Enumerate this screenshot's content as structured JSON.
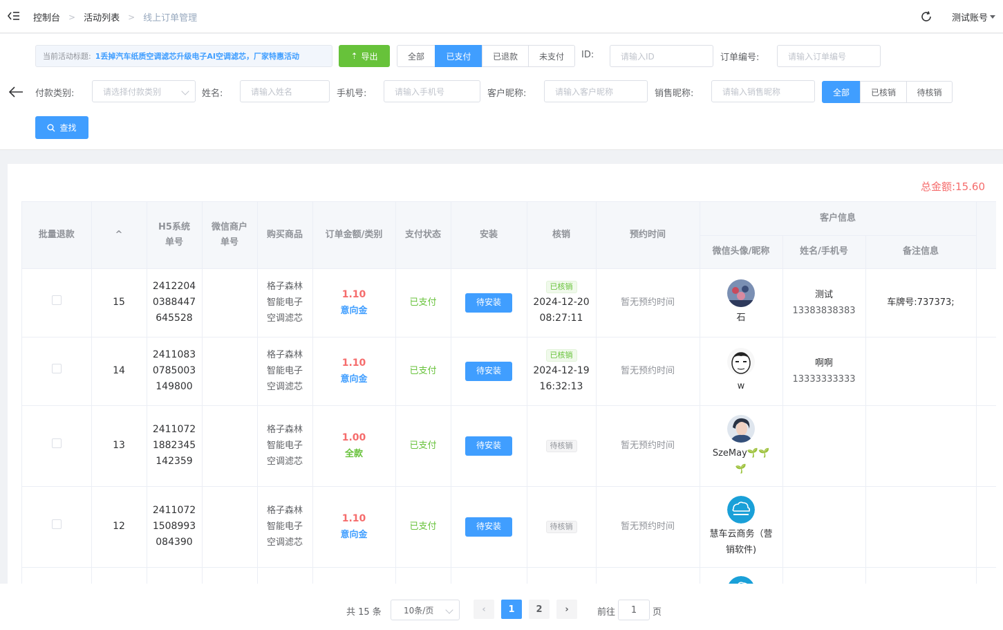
{
  "header": {
    "breadcrumbs": [
      "控制台",
      "活动列表",
      "线上订单管理"
    ],
    "account": "测试账号"
  },
  "filters": {
    "activity_label": "当前活动标题:",
    "activity_title": "1丢掉汽车纸质空调滤芯升级电子AI空调滤芯，厂家特惠活动",
    "export_label": "导出",
    "pay_status_tabs": [
      "全部",
      "已支付",
      "已退款",
      "未支付"
    ],
    "pay_status_active": "已支付",
    "id_label": "ID:",
    "id_placeholder": "请输入ID",
    "order_no_label": "订单编号:",
    "order_no_placeholder": "请输入订单编号",
    "pay_type_label": "付款类别:",
    "pay_type_placeholder": "请选择付款类别",
    "name_label": "姓名:",
    "name_placeholder": "请输入姓名",
    "phone_label": "手机号:",
    "phone_placeholder": "请输入手机号",
    "customer_nick_label": "客户昵称:",
    "customer_nick_placeholder": "请输入客户昵称",
    "sales_nick_label": "销售昵称:",
    "sales_nick_placeholder": "请输入销售昵称",
    "verify_tabs": [
      "全部",
      "已核销",
      "待核销"
    ],
    "verify_active": "全部",
    "search_label": "查找"
  },
  "summary": {
    "total_label": "总金额:",
    "total_value": "15.60"
  },
  "table": {
    "headers": {
      "batch_refund": "批量退款",
      "sort": "^",
      "h5_order": [
        "H5系统",
        "单号"
      ],
      "wx_order": [
        "微信商户",
        "单号"
      ],
      "product": "购买商品",
      "amount_type": "订单金额/类别",
      "pay_status": "支付状态",
      "install": "安装",
      "verify": "核销",
      "appointment": "预约时间",
      "customer_info": "客户信息",
      "wx_avatar": "微信头像/昵称",
      "name_phone": "姓名/手机号",
      "remark": "备注信息"
    },
    "rows": [
      {
        "id": "15",
        "h5": [
          "2412204",
          "0388447",
          "645528"
        ],
        "product": [
          "格子森林",
          "智能电子",
          "空调滤芯"
        ],
        "amount": "1.10",
        "type": "意向金",
        "type_color": "blue",
        "pay_status": "已支付",
        "install": "待安装",
        "verify_tag": "已核销",
        "verified": true,
        "verify_date": "2024-12-20",
        "verify_time": "08:27:11",
        "appointment": "暂无预约时间",
        "avatar_icon": "crowd-photo-avatar",
        "nick": [
          "石"
        ],
        "name": "测试",
        "phone": "13383838383",
        "remark": "车牌号:737373;"
      },
      {
        "id": "14",
        "h5": [
          "2411083",
          "0785003",
          "149800"
        ],
        "product": [
          "格子森林",
          "智能电子",
          "空调滤芯"
        ],
        "amount": "1.10",
        "type": "意向金",
        "type_color": "blue",
        "pay_status": "已支付",
        "install": "待安装",
        "verify_tag": "已核销",
        "verified": true,
        "verify_date": "2024-12-19",
        "verify_time": "16:32:13",
        "appointment": "暂无预约时间",
        "avatar_icon": "cartoon-face-avatar",
        "nick": [
          "w"
        ],
        "name": "啊啊",
        "phone": "13333333333",
        "remark": ""
      },
      {
        "id": "13",
        "h5": [
          "2411072",
          "1882345",
          "142359"
        ],
        "product": [
          "格子森林",
          "智能电子",
          "空调滤芯"
        ],
        "amount": "1.00",
        "type": "全款",
        "type_color": "green",
        "pay_status": "已支付",
        "install": "待安装",
        "verify_tag": "待核销",
        "verified": false,
        "verify_date": "",
        "verify_time": "",
        "appointment": "暂无预约时间",
        "avatar_icon": "portrait-avatar",
        "nick": [
          "SzeMay🌱🌱",
          "🌱"
        ],
        "name": "",
        "phone": "",
        "remark": ""
      },
      {
        "id": "12",
        "h5": [
          "2411072",
          "1508993",
          "084390"
        ],
        "product": [
          "格子森林",
          "智能电子",
          "空调滤芯"
        ],
        "amount": "1.10",
        "type": "意向金",
        "type_color": "blue",
        "pay_status": "已支付",
        "install": "待安装",
        "verify_tag": "待核销",
        "verified": false,
        "verify_date": "",
        "verify_time": "",
        "appointment": "暂无预约时间",
        "avatar_icon": "company-logo-avatar",
        "nick": [
          "慧车云商务（营",
          "销软件)"
        ],
        "name": "",
        "phone": "",
        "remark": ""
      }
    ]
  },
  "pagination": {
    "total_text": "共 15 条",
    "page_size": "10条/页",
    "pages": [
      "1",
      "2"
    ],
    "current_page": "1",
    "goto_label": "前往",
    "goto_value": "1",
    "page_suffix": "页"
  },
  "colors": {
    "primary": "#409eff",
    "success": "#67c23a",
    "danger": "#f56c6c",
    "muted": "#909399"
  }
}
